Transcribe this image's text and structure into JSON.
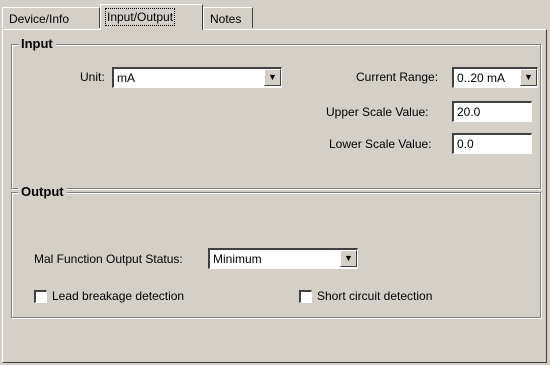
{
  "tabs": {
    "device_info": "Device/Info",
    "input_output": "Input/Output",
    "notes": "Notes"
  },
  "input": {
    "title": "Input",
    "unit_label": "Unit:",
    "unit_value": "mA",
    "current_range_label": "Current Range:",
    "current_range_value": "0..20 mA",
    "upper_scale_label": "Upper Scale Value:",
    "upper_scale_value": "20.0",
    "lower_scale_label": "Lower Scale Value:",
    "lower_scale_value": "0.0"
  },
  "output": {
    "title": "Output",
    "malfunction_label": "Mal Function Output Status:",
    "malfunction_value": "Minimum",
    "lead_breakage_label": "Lead breakage detection",
    "lead_breakage_checked": false,
    "short_circuit_label": "Short circuit detection",
    "short_circuit_checked": false
  },
  "icons": {
    "dropdown": "chevron-down-icon"
  }
}
